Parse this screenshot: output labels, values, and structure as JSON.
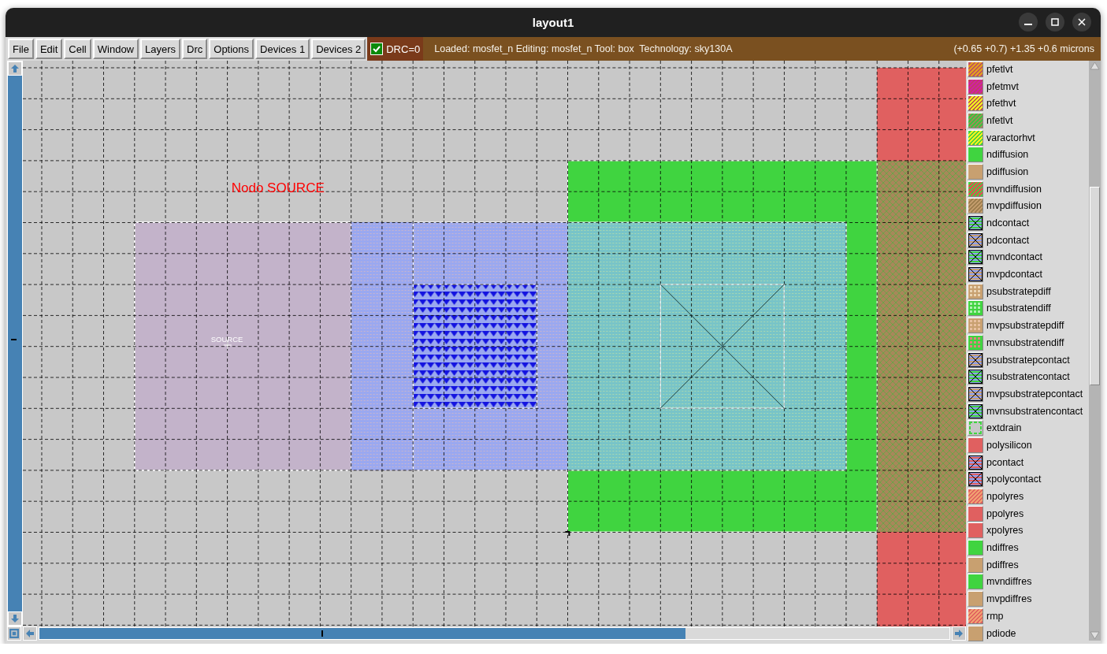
{
  "window": {
    "title": "layout1"
  },
  "menu": [
    "File",
    "Edit",
    "Cell",
    "Window",
    "Layers",
    "Drc",
    "Options",
    "Devices 1",
    "Devices 2"
  ],
  "drc": {
    "checked": true,
    "label": "DRC=0"
  },
  "status": {
    "info": "Loaded: mosfet_n Editing: mosfet_n Tool: box  Technology: sky130A",
    "coords": "(+0.65 +0.7) +1.35 +0.6 microns"
  },
  "canvas": {
    "annotation": "Nodo SOURCE",
    "port_label": "SOURCE"
  },
  "layers": [
    {
      "name": "pfetlvt",
      "kind": "hatch",
      "color": "#c05060",
      "stripe": {
        "color": "#e0a020"
      }
    },
    {
      "name": "pfetmvt",
      "kind": "hatch",
      "color": "#c04060",
      "stripe": {
        "color": "#d020a0"
      }
    },
    {
      "name": "pfethvt",
      "kind": "hatch",
      "color": "#c05050",
      "stripe": {
        "color": "#f0f020"
      }
    },
    {
      "name": "nfetlvt",
      "kind": "hatch",
      "color": "#a8875a",
      "stripe": {
        "color": "#40c040"
      }
    },
    {
      "name": "varactorhvt",
      "kind": "hatch",
      "color": "#40d040",
      "stripe": {
        "color": "#f0f020"
      }
    },
    {
      "name": "ndiffusion",
      "kind": "solid",
      "color": "#40d440",
      "stripe": {
        "color": "#40d440"
      }
    },
    {
      "name": "pdiffusion",
      "kind": "solid",
      "color": "#c8a070",
      "stripe": {
        "color": "#c8a070"
      }
    },
    {
      "name": "mvndiffusion",
      "kind": "hatch",
      "color": "#40d440",
      "stripe": {
        "color": "#e05050"
      }
    },
    {
      "name": "mvpdiffusion",
      "kind": "hatch",
      "color": "#c8a070",
      "stripe": {
        "color": "#a08050"
      }
    },
    {
      "name": "ndcontact",
      "kind": "contact",
      "color": "#8fa0f0",
      "stripe": {
        "color": "#40d440"
      }
    },
    {
      "name": "pdcontact",
      "kind": "contact",
      "color": "#8fa0f0",
      "stripe": {
        "color": "#c8a070"
      }
    },
    {
      "name": "mvndcontact",
      "kind": "contact",
      "color": "#8fa0f0",
      "stripe": {
        "color": "#40d440"
      }
    },
    {
      "name": "mvpdcontact",
      "kind": "contact",
      "color": "#8fa0f0",
      "stripe": {
        "color": "#c8a070"
      }
    },
    {
      "name": "psubstratepdiff",
      "kind": "dots",
      "color": "#c8a070",
      "stripe": {
        "color": "#ead4b4"
      }
    },
    {
      "name": "nsubstratendiff",
      "kind": "dots",
      "color": "#40d440",
      "stripe": {
        "color": "#b0f0b0"
      }
    },
    {
      "name": "mvpsubstratepdiff",
      "kind": "dots",
      "color": "#c8a070",
      "stripe": {
        "color": "#e8c0a0"
      }
    },
    {
      "name": "mvnsubstratendiff",
      "kind": "dots",
      "color": "#40d440",
      "stripe": {
        "color": "#e08080"
      }
    },
    {
      "name": "psubstratepcontact",
      "kind": "contact",
      "color": "#8fa0f0",
      "stripe": {
        "color": "#c8a070"
      }
    },
    {
      "name": "nsubstratencontact",
      "kind": "contact",
      "color": "#8fa0f0",
      "stripe": {
        "color": "#40d440"
      }
    },
    {
      "name": "mvpsubstratepcontact",
      "kind": "contact",
      "color": "#8fa0f0",
      "stripe": {
        "color": "#c8a070"
      }
    },
    {
      "name": "mvnsubstratencontact",
      "kind": "contact",
      "color": "#8fa0f0",
      "stripe": {
        "color": "#40d440"
      }
    },
    {
      "name": "extdrain",
      "kind": "outline",
      "color": "#c8c8c8",
      "stripe": {
        "color": "#40d440"
      }
    },
    {
      "name": "polysilicon",
      "kind": "solid",
      "color": "#e06060",
      "stripe": {
        "color": "#e06060"
      }
    },
    {
      "name": "pcontact",
      "kind": "contact",
      "color": "#8fa0f0",
      "stripe": {
        "color": "#e06060"
      }
    },
    {
      "name": "xpolycontact",
      "kind": "contact",
      "color": "#8fa0f0",
      "stripe": {
        "color": "#e06060"
      }
    },
    {
      "name": "npolyres",
      "kind": "hatch",
      "color": "#e06060",
      "stripe": {
        "color": "#f0a070"
      }
    },
    {
      "name": "ppolyres",
      "kind": "solid",
      "color": "#e06060",
      "stripe": {
        "color": "#e06060"
      }
    },
    {
      "name": "xpolyres",
      "kind": "solid",
      "color": "#e06060",
      "stripe": {
        "color": "#e06060"
      }
    },
    {
      "name": "ndiffres",
      "kind": "solid",
      "color": "#40d440",
      "stripe": {
        "color": "#40d440"
      }
    },
    {
      "name": "pdiffres",
      "kind": "solid",
      "color": "#c8a070",
      "stripe": {
        "color": "#c8a070"
      }
    },
    {
      "name": "mvndiffres",
      "kind": "solid",
      "color": "#40d440",
      "stripe": {
        "color": "#40d440"
      }
    },
    {
      "name": "mvpdiffres",
      "kind": "solid",
      "color": "#c8a070",
      "stripe": {
        "color": "#c8a070"
      }
    },
    {
      "name": "rmp",
      "kind": "hatch",
      "color": "#e06060",
      "stripe": {
        "color": "#f0a070"
      }
    },
    {
      "name": "pdiode",
      "kind": "solid",
      "color": "#c8a070",
      "stripe": {
        "color": "#c8a070"
      }
    }
  ]
}
